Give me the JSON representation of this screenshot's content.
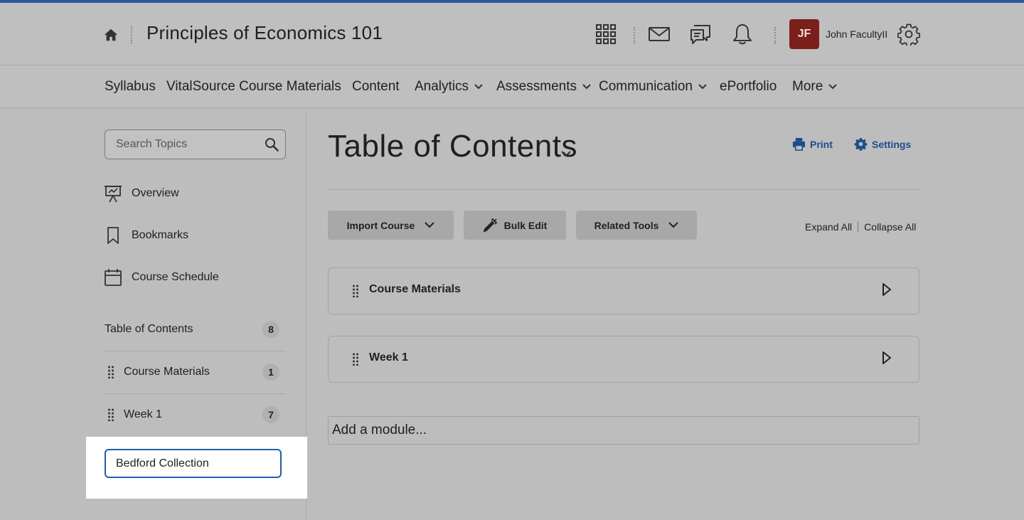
{
  "header": {
    "course_title": "Principles of Economics 101",
    "user_initials": "JF",
    "user_name": "John FacultyII"
  },
  "nav": {
    "items": [
      {
        "label": "Syllabus",
        "dropdown": false
      },
      {
        "label": "VitalSource Course Materials",
        "dropdown": false
      },
      {
        "label": "Content",
        "dropdown": false
      },
      {
        "label": "Analytics",
        "dropdown": true
      },
      {
        "label": "Assessments",
        "dropdown": true
      },
      {
        "label": "Communication",
        "dropdown": true
      },
      {
        "label": "ePortfolio",
        "dropdown": false
      },
      {
        "label": "More",
        "dropdown": true
      }
    ]
  },
  "sidebar": {
    "search_placeholder": "Search Topics",
    "links": [
      {
        "label": "Overview",
        "icon": "presentation-icon"
      },
      {
        "label": "Bookmarks",
        "icon": "bookmark-icon"
      },
      {
        "label": "Course Schedule",
        "icon": "calendar-icon"
      }
    ],
    "toc": {
      "label": "Table of Contents",
      "count": "8"
    },
    "modules": [
      {
        "label": "Course Materials",
        "count": "1"
      },
      {
        "label": "Week 1",
        "count": "7"
      }
    ],
    "new_module_value": "Bedford Collection"
  },
  "main": {
    "page_title": "Table of Contents",
    "print_label": "Print",
    "settings_label": "Settings",
    "import_course_label": "Import Course",
    "bulk_edit_label": "Bulk Edit",
    "related_tools_label": "Related Tools",
    "expand_all_label": "Expand All",
    "collapse_all_label": "Collapse All",
    "modules": [
      {
        "title": "Course Materials"
      },
      {
        "title": "Week 1"
      }
    ],
    "add_module_placeholder": "Add a module..."
  },
  "colors": {
    "top_accent": "#2b5797",
    "avatar_bg": "#7a1f1a",
    "link_blue": "#1c4d8c",
    "focus_border": "#1e5ea8"
  }
}
